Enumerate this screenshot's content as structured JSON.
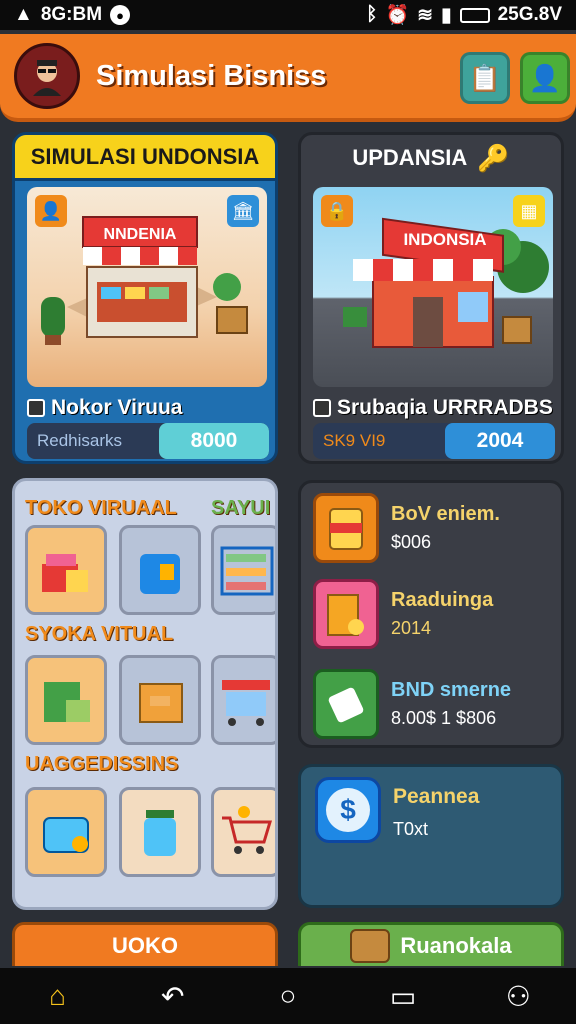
{
  "status_bar": {
    "left_text": "8G:BM",
    "right_text": "25G.8V",
    "icons": [
      "warning-icon",
      "notification-icon",
      "bluetooth-icon",
      "alarm-icon",
      "wifi-icon",
      "signal-icon",
      "battery-icon"
    ]
  },
  "app_bar": {
    "title": "Simulasi Bisniss",
    "avatar_icon": "avatar-icon",
    "buttons": [
      {
        "name": "clipboard-button",
        "icon": "clipboard-icon",
        "color": "#3fa39b"
      },
      {
        "name": "add-user-button",
        "icon": "add-user-icon",
        "color": "#4caf3a"
      }
    ]
  },
  "business_cards": [
    {
      "title": "SIMULASI UNDONSIA",
      "shop_label": "Nokor Viruua",
      "price_label": "Redhisarks",
      "price_value": "8000",
      "price_color": "#5fcfd6",
      "sign_text": "NNDENIA"
    },
    {
      "title": "UPDANSIA",
      "shop_label": "Srubaqia URRRADBS",
      "price_label": "SK9 VI9",
      "price_value": "2004",
      "price_color": "#2e8fd8",
      "sign_text": "INDONSIA"
    }
  ],
  "catalog": {
    "sections": [
      {
        "label": "TOKO VIRUAAL",
        "side_label": "SAYUI UI"
      },
      {
        "label": "SYOKA VITUAL"
      },
      {
        "label": "UAGGEDISSINS"
      }
    ]
  },
  "resources": [
    {
      "title": "BoV eniem.",
      "value": "$006"
    },
    {
      "title": "Raaduinga",
      "value": "2014"
    },
    {
      "title": "BND smerne",
      "value": "8.00$ 1 $806"
    }
  ],
  "promo": {
    "title": "Peannea",
    "subtitle": "T0xt"
  },
  "bottom_buttons": {
    "left_label": "UOKO",
    "right_label": "Ruanokala"
  },
  "nav_bar": {
    "items": [
      "home-icon",
      "back-icon",
      "circle-home-icon",
      "chat-icon",
      "profile-icon"
    ]
  },
  "colors": {
    "accent_orange": "#f07a21",
    "panel_blue": "#1f6fb0",
    "panel_dark": "#3a3d45",
    "highlight_yellow": "#f7d21b"
  }
}
